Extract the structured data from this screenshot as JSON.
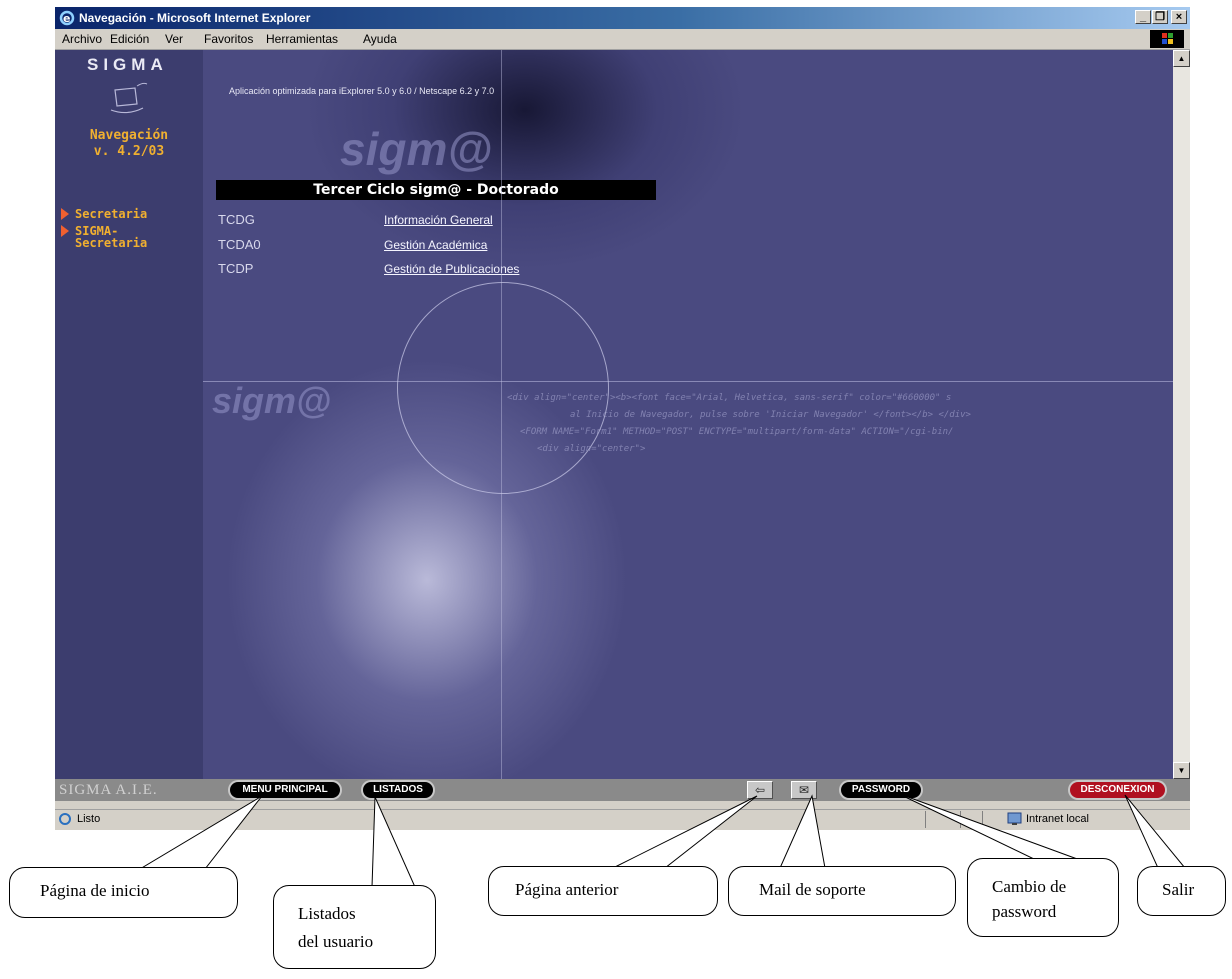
{
  "window": {
    "title": "Navegación - Microsoft Internet Explorer"
  },
  "menu": [
    "Archivo",
    "Edición",
    "Ver",
    "Favoritos",
    "Herramientas",
    "Ayuda"
  ],
  "sidebar": {
    "logo": "SIGMA",
    "nav_title": "Navegación",
    "version": "v. 4.2/03",
    "items": [
      {
        "label": "Secretaria"
      },
      {
        "label": "SIGMA-Secretaria"
      }
    ]
  },
  "main": {
    "optimized_note": "Aplicación optimizada para iExplorer 5.0 y 6.0 / Netscape 6.2 y 7.0",
    "watermark": "sigm@",
    "section_title": "Tercer Ciclo sigm@ - Doctorado",
    "rows": [
      {
        "code": "TCDG",
        "link": "Información General"
      },
      {
        "code": "TCDA0",
        "link": "Gestión Académica"
      },
      {
        "code": "TCDP",
        "link": "Gestión de Publicaciones"
      }
    ],
    "code_background": [
      "<div align=\"center\"><b><font face=\"Arial, Helvetica, sans-serif\" color=\"#660000\" s",
      "al Inicio de Navegador, pulse sobre 'Iniciar Navegador' </font></b> </div>",
      "<FORM NAME=\"Form1\" METHOD=\"POST\" ENCTYPE=\"multipart/form-data\" ACTION=\"/cgi-bin/",
      "<div align=\"center\">"
    ]
  },
  "toolbar": {
    "brand": "SIGMA A.I.E.",
    "menu_principal": "MENU PRINCIPAL",
    "listados": "LISTADOS",
    "password": "PASSWORD",
    "desconexion": "DESCONEXION"
  },
  "statusbar": {
    "status": "Listo",
    "zone": "Intranet local"
  },
  "callouts": {
    "inicio": "Página de inicio",
    "listados_1": "Listados",
    "listados_2": "del usuario",
    "anterior": "Página anterior",
    "mail": "Mail de soporte",
    "password_1": "Cambio de",
    "password_2": "password",
    "salir": "Salir"
  },
  "colors": {
    "accent": "#f0b030",
    "background": "#4a4a80",
    "sidebar": "#3c3d6e",
    "desconexion": "#b01020"
  }
}
